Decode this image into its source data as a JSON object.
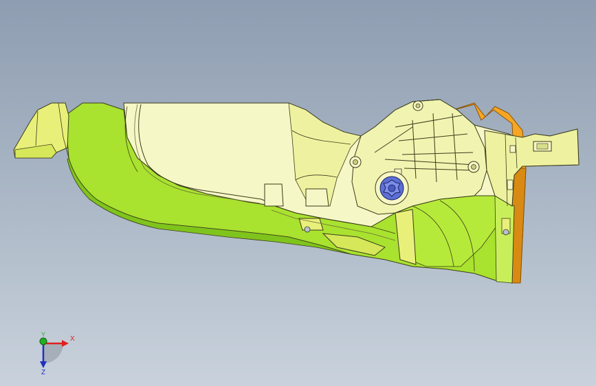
{
  "viewport": {
    "colors": {
      "background_top": "#8e9db1",
      "background_bottom": "#c9d2dc",
      "part_light": "#f6f7c6",
      "part_medium": "#e9f07a",
      "part_green": "#a9e22f",
      "part_dark_green": "#7fc41c",
      "edge": "#3a3a1a",
      "bracket_orange": "#f5a623",
      "bracket_dark": "#c77b0c",
      "knob_blue": "#5c6fd6"
    }
  },
  "triad": {
    "x_label": "X",
    "y_label": "Y",
    "z_label": "Z",
    "colors": {
      "x": "#e02020",
      "y": "#20b020",
      "z": "#2030c0"
    }
  }
}
